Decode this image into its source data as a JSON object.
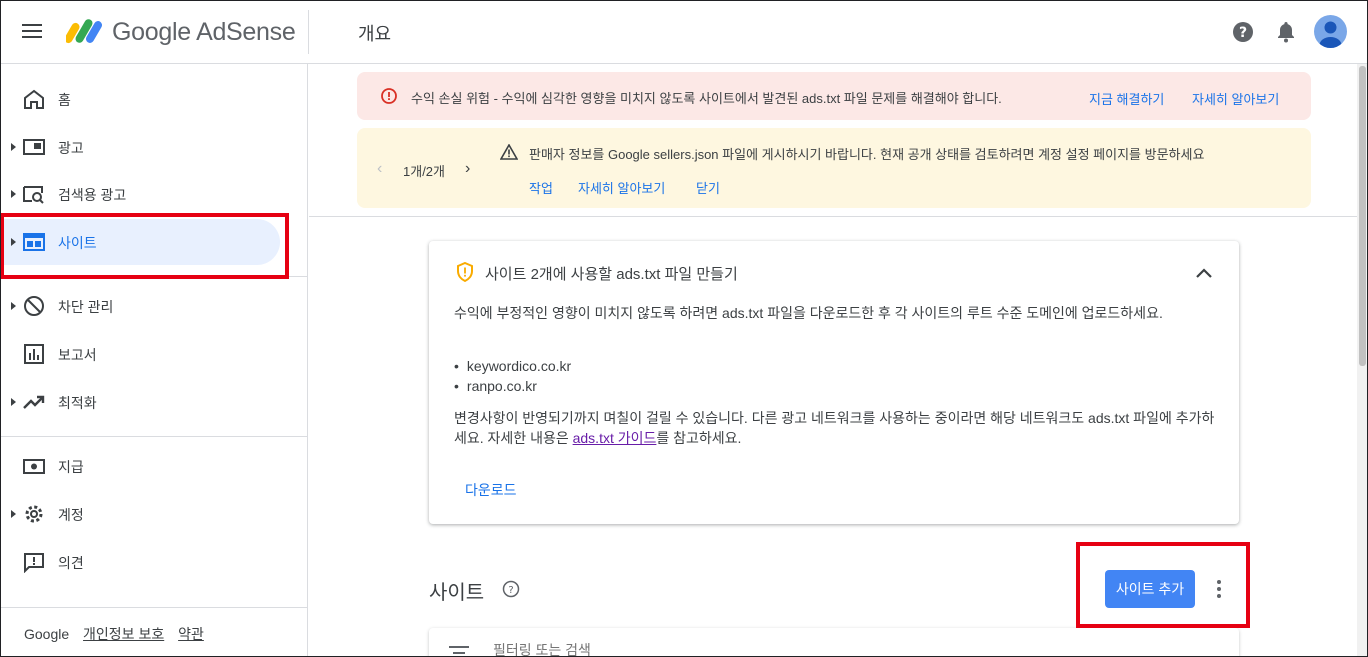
{
  "header": {
    "logo_text": "Google AdSense",
    "page_title": "개요"
  },
  "sidebar": {
    "items": [
      {
        "label": "홈",
        "icon": "home-icon"
      },
      {
        "label": "광고",
        "icon": "ads-icon"
      },
      {
        "label": "검색용 광고",
        "icon": "search-ads-icon"
      },
      {
        "label": "사이트",
        "icon": "sites-icon"
      },
      {
        "label": "차단 관리",
        "icon": "block-icon"
      },
      {
        "label": "보고서",
        "icon": "reports-icon"
      },
      {
        "label": "최적화",
        "icon": "optimize-icon"
      },
      {
        "label": "지급",
        "icon": "payments-icon"
      },
      {
        "label": "계정",
        "icon": "gear-icon"
      },
      {
        "label": "의견",
        "icon": "feedback-icon"
      }
    ],
    "footer": {
      "brand": "Google",
      "privacy": "개인정보 보호",
      "terms": "약관"
    }
  },
  "alerts": {
    "red": {
      "message": "수익 손실 위험 - 수익에 심각한 영향을 미치지 않도록 사이트에서 발견된 ads.txt 파일 문제를 해결해야 합니다.",
      "fix": "지금 해결하기",
      "learn": "자세히 알아보기"
    },
    "yellow": {
      "pager": "1개/2개",
      "message": "판매자 정보를 Google sellers.json 파일에 게시하시기 바랍니다. 현재 공개 상태를 검토하려면 계정 설정 페이지를 방문하세요",
      "action": "작업",
      "learn": "자세히 알아보기",
      "close": "닫기"
    }
  },
  "card": {
    "title": "사이트 2개에 사용할 ads.txt 파일 만들기",
    "description": "수익에 부정적인 영향이 미치지 않도록 하려면 ads.txt 파일을 다운로드한 후 각 사이트의 루트 수준 도메인에 업로드하세요.",
    "sites": [
      "keywordico.co.kr",
      "ranpo.co.kr"
    ],
    "note_before": "변경사항이 반영되기까지 며칠이 걸릴 수 있습니다. 다른 광고 네트워크를 사용하는 중이라면 해당 네트워크도 ads.txt 파일에 추가하세요. 자세한 내용은 ",
    "note_link": "ads.txt 가이드",
    "note_after": "를 참고하세요.",
    "download": "다운로드"
  },
  "sites_section": {
    "title": "사이트",
    "add_button": "사이트 추가",
    "filter_placeholder": "필터링 또는 검색"
  },
  "colors": {
    "accent": "#1a73e8",
    "button": "#4285f4",
    "error_bg": "#fce8e6",
    "warning_bg": "#fef7e0",
    "highlight": "#e60012"
  }
}
